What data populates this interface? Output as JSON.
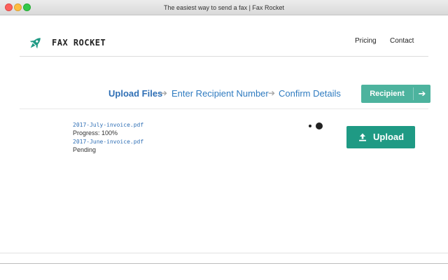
{
  "window": {
    "title": "The easiest way to send a fax | Fax Rocket"
  },
  "brand": {
    "name": "FAX ROCKET",
    "icon": "rocket-icon",
    "color": "#1f9a84"
  },
  "nav": {
    "pricing": "Pricing",
    "contact": "Contact"
  },
  "steps": [
    {
      "label": "Upload Files",
      "active": true
    },
    {
      "label": "Enter Recipient Number",
      "active": false
    },
    {
      "label": "Confirm Details",
      "active": false
    }
  ],
  "next_button": {
    "label": "Recipient",
    "icon": "arrow-right-icon",
    "color": "#4db39e"
  },
  "files": [
    {
      "name": "2017-July-invoice.pdf",
      "status": "Progress: 100%",
      "progress": 1.0
    },
    {
      "name": "2017-June-invoice.pdf",
      "status": "Pending"
    }
  ],
  "upload_button": {
    "label": "Upload",
    "icon": "upload-icon",
    "color": "#1f9a84"
  }
}
